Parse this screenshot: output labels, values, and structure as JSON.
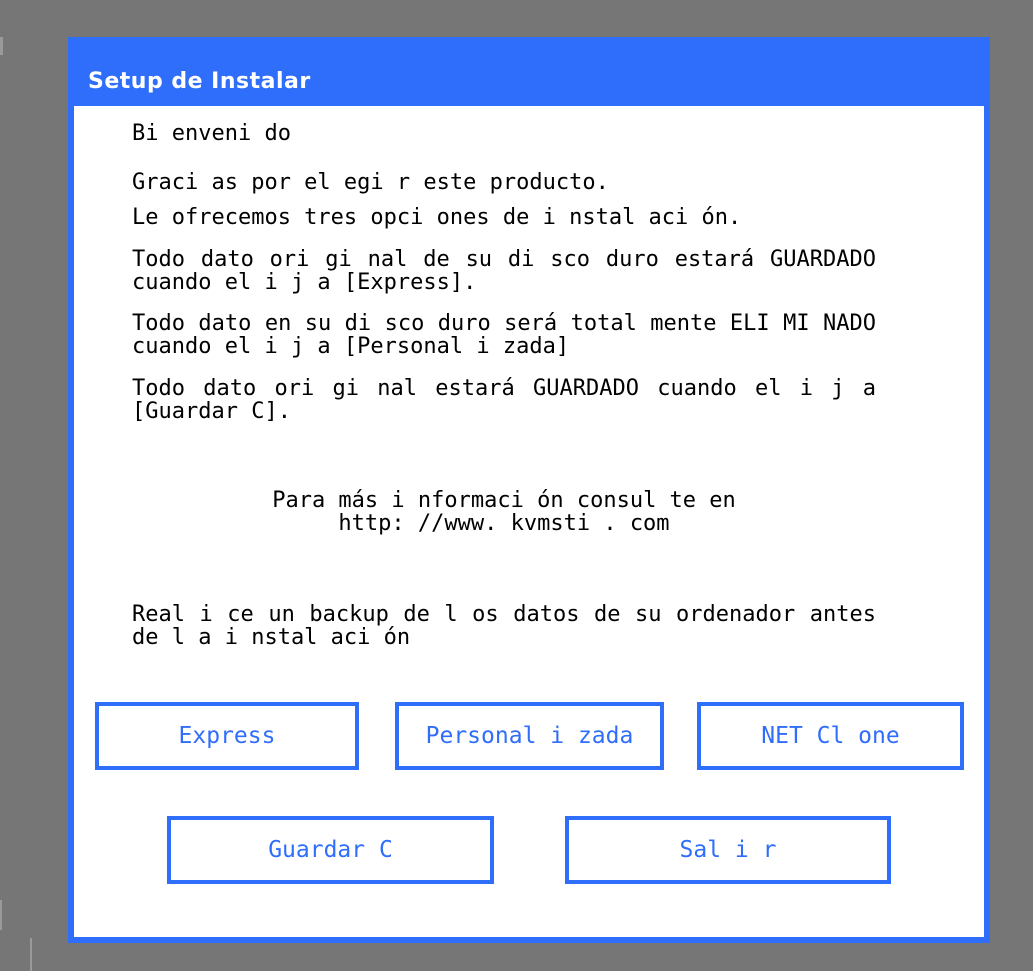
{
  "window": {
    "title": "Setup de Instalar"
  },
  "content": {
    "welcome": "Bi enveni do",
    "thanks": "Graci as por el egi r este producto.",
    "options_intro": "Le ofrecemos tres opci ones de i nstal aci ón.",
    "express_info": " Todo dato ori gi nal de su di sco duro estará GUARDADO cuando el i j a [Express].",
    "custom_info": "Todo dato en su di sco duro será total mente ELI MI NADO cuando el i j a [Personal i zada]",
    "save_info": "Todo dato ori gi nal estará GUARDADO cuando el i j a [Guardar C].",
    "more_info_line1": "Para más i nformaci ón consul te en",
    "more_info_line2": "http: //www. kvmsti . com",
    "backup_warning": "Real i ce un backup de l os datos de su ordenador antes de l a i nstal aci ón"
  },
  "buttons": {
    "express": "Express",
    "custom": "Personal i zada",
    "net_clone": "NET Cl one",
    "save_c": "Guardar C",
    "exit": "Sal i r"
  },
  "colors": {
    "accent": "#2f6dfb",
    "background": "#767676",
    "dialog": "#ffffff",
    "text": "#000000"
  }
}
